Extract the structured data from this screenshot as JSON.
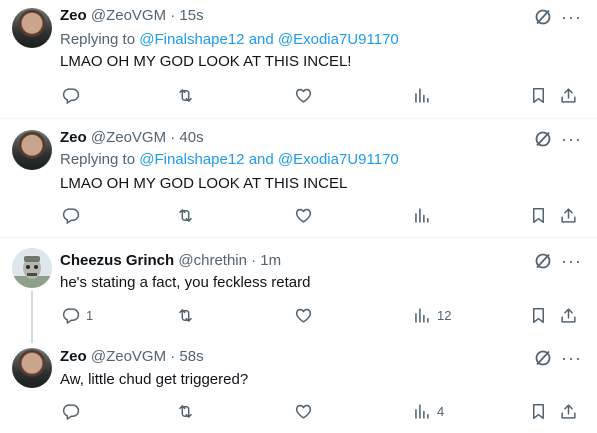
{
  "tweets": [
    {
      "name": "Zeo",
      "handle": "@ZeoVGM",
      "time": "· 15s",
      "replying_prefix": "Replying to",
      "mention1": "@Finalshape12",
      "and": "and",
      "mention2": "@Exodia7U91170",
      "text": "LMAO OH MY GOD LOOK AT THIS INCEL!",
      "reply_count": "",
      "views_count": ""
    },
    {
      "name": "Zeo",
      "handle": "@ZeoVGM",
      "time": "· 40s",
      "replying_prefix": "Replying to",
      "mention1": "@Finalshape12",
      "and": "and",
      "mention2": "@Exodia7U91170",
      "text": "LMAO OH MY GOD LOOK AT THIS INCEL",
      "reply_count": "",
      "views_count": ""
    },
    {
      "name": "Cheezus Grinch",
      "handle": "@chrethin",
      "time": "· 1m",
      "text": "he's stating a fact, you feckless retard",
      "reply_count": "1",
      "views_count": "12"
    },
    {
      "name": "Zeo",
      "handle": "@ZeoVGM",
      "time": "· 58s",
      "text": "Aw, little chud get triggered?",
      "reply_count": "",
      "views_count": "4"
    }
  ],
  "icons": {
    "reply": "reply-icon",
    "retweet": "retweet-icon",
    "like": "like-icon",
    "views": "views-icon",
    "bookmark": "bookmark-icon",
    "share": "share-icon",
    "grok": "grok-icon",
    "more": "more-icon"
  },
  "colors": {
    "text": "#0f1419",
    "secondary": "#536471",
    "link": "#1d9bf0",
    "divider": "#eff3f4"
  }
}
